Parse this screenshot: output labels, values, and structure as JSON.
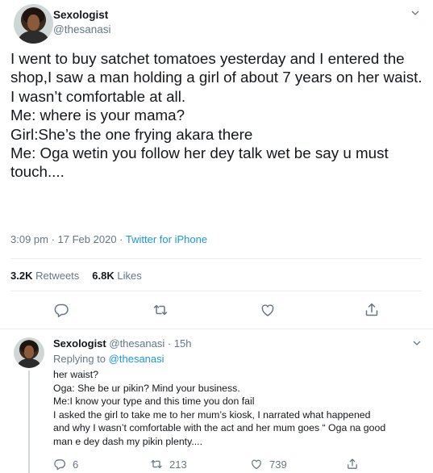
{
  "main_tweet": {
    "display_name": "Sexologist",
    "handle": "@thesanasi",
    "text": "I went to buy satchet tomatoes yesterday and I entered the shop,I saw a man holding a girl of about 7 years on her waist.\nI wasn’t comfortable at all.\nMe: where is your mama?\nGirl:She’s the one frying akara there\nMe: Oga wetin you follow her dey talk wet be say u must touch....",
    "time": "3:09 pm",
    "date": "17 Feb 2020",
    "separator": " · ",
    "source": "Twitter for iPhone",
    "retweets_count": "3.2K",
    "retweets_label": "Retweets",
    "likes_count": "6.8K",
    "likes_label": "Likes"
  },
  "reply_tweet": {
    "display_name": "Sexologist",
    "handle": "@thesanasi",
    "dot": "·",
    "time": "15h",
    "replying_prefix": "Replying to",
    "replying_to": "@thesanasi",
    "text": "her waist?\nOga: She be ur pikin? Mind your business.\nMe:I know your type and this time you don fail\nI asked the girl to take me to her mum’s kiosk, I narrated what happened\nand why I wasn’t comfortable with the act and her mum goes “ Oga na good\nman e dey dash my pikin plenty....",
    "reply_count": "6",
    "retweet_count": "213",
    "like_count": "739"
  },
  "icons": {
    "caret": "chevron-down-icon",
    "reply": "reply-icon",
    "retweet": "retweet-icon",
    "like": "heart-icon",
    "share": "share-icon"
  },
  "colors": {
    "text": "#14171a",
    "secondary": "#657786",
    "link": "#1b95e0",
    "divider": "#e6ecf0"
  }
}
